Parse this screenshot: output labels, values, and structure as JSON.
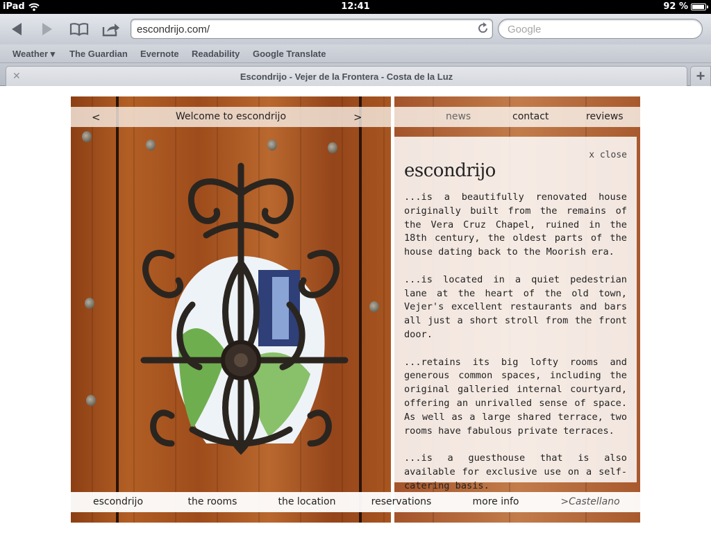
{
  "status_bar": {
    "device": "iPad",
    "time": "12:41",
    "battery_percent": "92 %",
    "battery_level": 0.92
  },
  "toolbar": {
    "url": "escondrijo.com/",
    "search_placeholder": "Google"
  },
  "bookmarks": [
    {
      "label": "Weather ▾"
    },
    {
      "label": "The Guardian"
    },
    {
      "label": "Evernote"
    },
    {
      "label": "Readability"
    },
    {
      "label": "Google Translate"
    }
  ],
  "tab": {
    "title": "Escondrijo - Vejer de la Frontera - Costa de la Luz",
    "close_glyph": "✕",
    "add_glyph": "+"
  },
  "site": {
    "slider": {
      "prev": "<",
      "caption": "Welcome to escondrijo",
      "next": ">"
    },
    "top_nav": [
      {
        "label": "news"
      },
      {
        "label": "contact"
      },
      {
        "label": "reviews"
      }
    ],
    "panel": {
      "close": "x close",
      "title": "escondrijo",
      "paragraphs": [
        "...is a beautifully renovated house originally built from the remains of the Vera Cruz Chapel, ruined in the 18th century, the oldest parts of the house dating back to the Moorish era.",
        "...is located in a quiet pedestrian lane at the heart of the old town, Vejer's excellent restaurants and bars all just a short stroll from the front door.",
        "...retains its big lofty rooms and generous common spaces, including the original galleried internal courtyard, offering an unrivalled sense of space. As well as a large shared terrace, two rooms have fabulous private terraces.",
        "...is a guesthouse that is also available for exclusive use on a self-catering basis."
      ]
    },
    "bottom_nav": [
      {
        "label": "escondrijo"
      },
      {
        "label": "the rooms"
      },
      {
        "label": "the location"
      },
      {
        "label": "reservations"
      },
      {
        "label": "more info"
      },
      {
        "label": ">Castellano"
      }
    ]
  },
  "icons": [
    "wifi-icon",
    "back-arrow-icon",
    "forward-arrow-icon",
    "bookmarks-book-icon",
    "share-icon",
    "reload-icon"
  ],
  "colors": {
    "door_wood": "#a85620",
    "ui_chrome": "#c6cbd4"
  }
}
